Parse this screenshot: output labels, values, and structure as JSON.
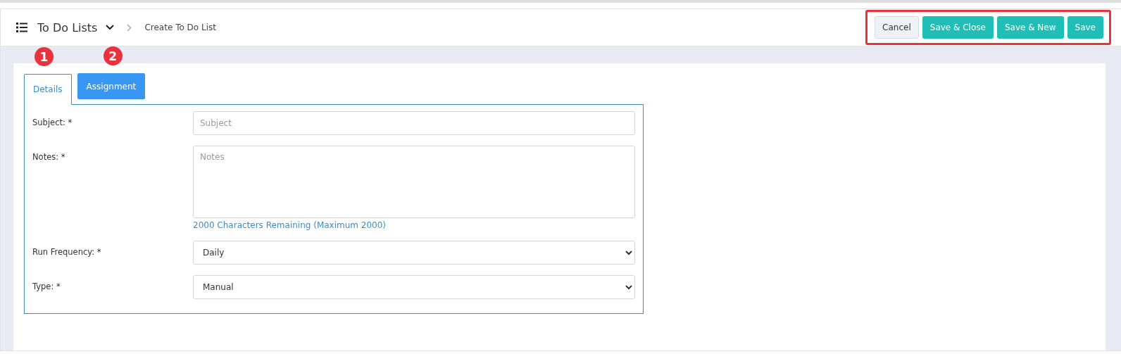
{
  "header": {
    "title": "To Do Lists",
    "breadcrumb": "Create To Do List"
  },
  "actions": [
    {
      "label": "Cancel",
      "kind": "secondary"
    },
    {
      "label": "Save & Close",
      "kind": "primary"
    },
    {
      "label": "Save & New",
      "kind": "primary"
    },
    {
      "label": "Save",
      "kind": "primary"
    }
  ],
  "tabs": [
    {
      "label": "Details",
      "selected": true,
      "badge": "1"
    },
    {
      "label": "Assignment",
      "selected": false,
      "badge": "2"
    }
  ],
  "fields": [
    {
      "label": "Subject: *",
      "kind": "text",
      "placeholder": "Subject"
    },
    {
      "label": "Notes: *",
      "kind": "textarea",
      "placeholder": "Notes",
      "hint": "2000 Characters Remaining (Maximum 2000)"
    },
    {
      "label": "Run Frequency: *",
      "kind": "select",
      "value": "Daily"
    },
    {
      "label": "Type: *",
      "kind": "select",
      "value": "Manual"
    }
  ]
}
